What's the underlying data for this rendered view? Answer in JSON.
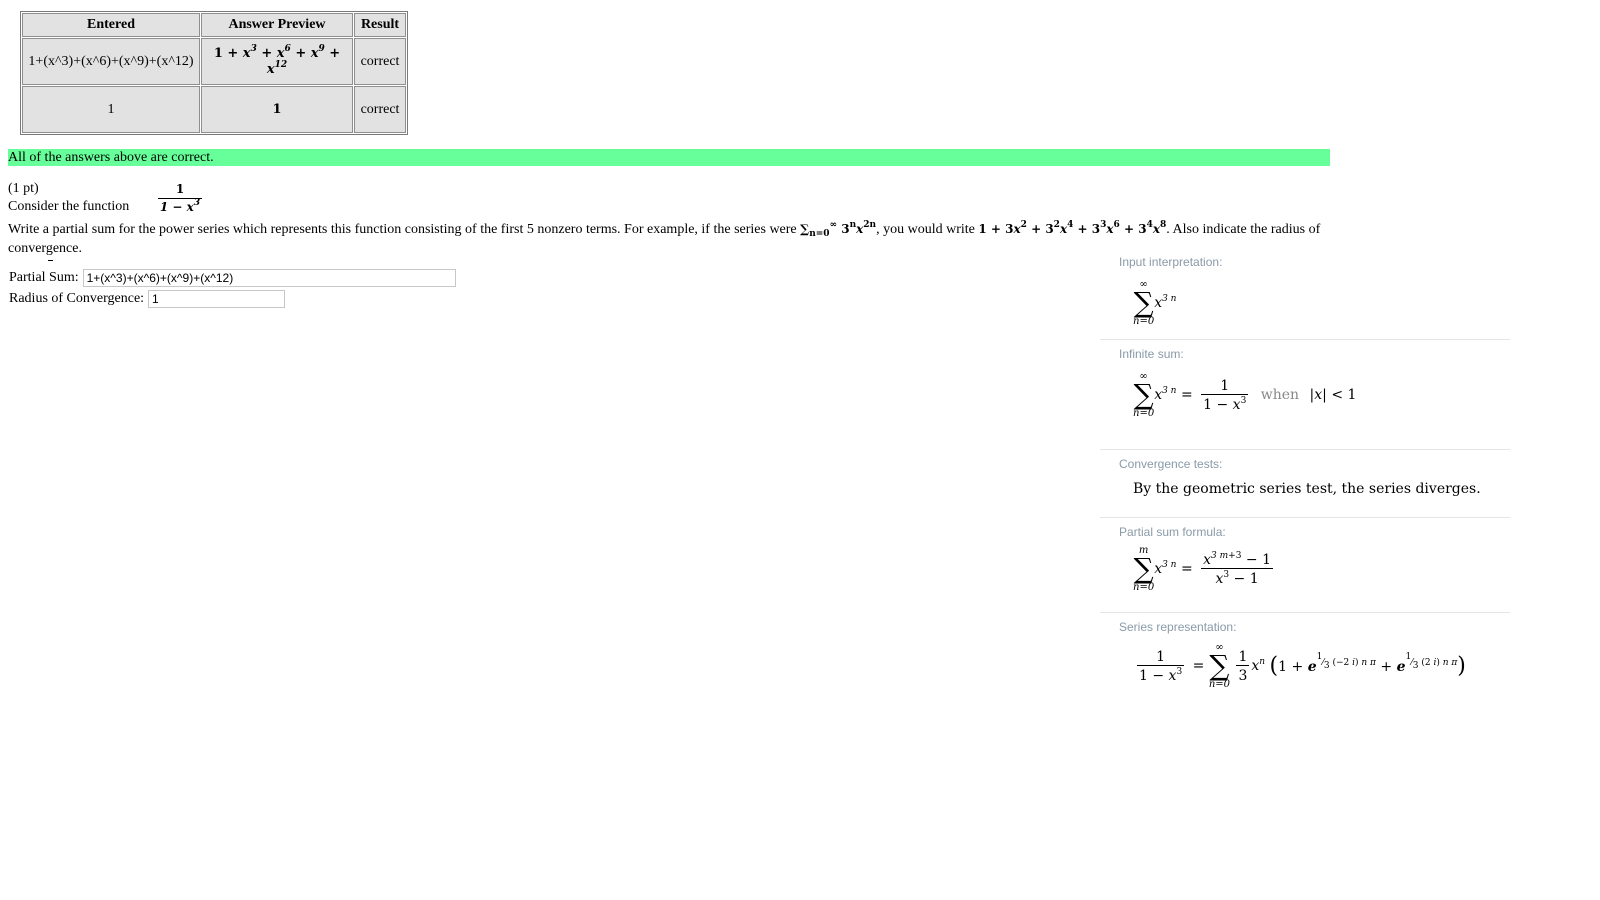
{
  "results_table": {
    "headers": [
      "Entered",
      "Answer Preview",
      "Result"
    ],
    "rows": [
      {
        "entered": "1+(x^3)+(x^6)+(x^9)+(x^12)",
        "result": "correct"
      },
      {
        "entered": "1",
        "preview": "1",
        "result": "correct"
      }
    ]
  },
  "banner": "All of the answers above are correct.",
  "problem": {
    "points": "(1 pt)",
    "consider": "Consider the function",
    "instruction_start": "Write a partial sum for the power series which represents this function consisting of the first 5 nonzero terms. For example, if the series were",
    "instruction_mid": ", you would write",
    "instruction_end": ". Also indicate the radius of convergence."
  },
  "fields": {
    "partial_sum_label": "Partial Sum:",
    "partial_sum_value": "1+(x^3)+(x^6)+(x^9)+(x^12)",
    "radius_label": "Radius of Convergence:",
    "radius_value": "1"
  },
  "panel": {
    "input_title": "Input interpretation:",
    "infinite_title": "Infinite sum:",
    "when_text": "when",
    "convergence_title": "Convergence tests:",
    "convergence_text": "By the geometric series test, the series diverges.",
    "partial_title": "Partial sum formula:",
    "series_title": "Series representation:"
  }
}
